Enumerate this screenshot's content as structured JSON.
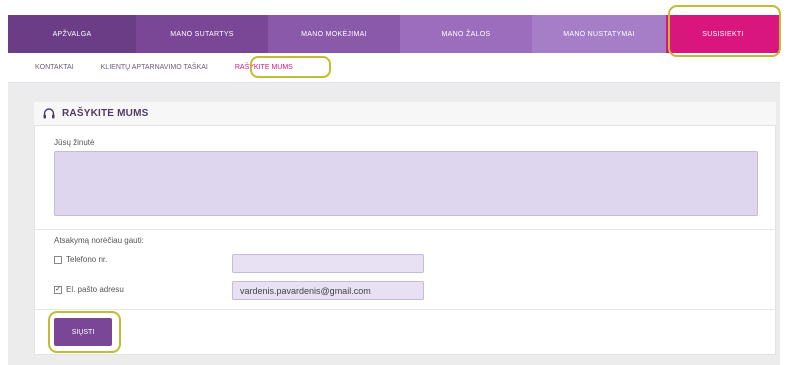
{
  "topnav": {
    "tabs": [
      {
        "label": "APŽVALGA"
      },
      {
        "label": "MANO SUTARTYS"
      },
      {
        "label": "MANO MOKĖJIMAI"
      },
      {
        "label": "MANO ŽALOS"
      },
      {
        "label": "MANO NUSTATYMAI"
      },
      {
        "label": "SUSISIEKTI"
      }
    ],
    "active": "SUSISIEKTI"
  },
  "subnav": {
    "items": [
      {
        "label": "KONTAKTAI"
      },
      {
        "label": "KLIENTŲ APTARNAVIMO TAŠKAI"
      },
      {
        "label": "RAŠYKITE MUMS"
      }
    ],
    "active": "RAŠYKITE MUMS"
  },
  "form": {
    "title": "RAŠYKITE MUMS",
    "message_label": "Jūsų žinutė",
    "message_value": "",
    "reply_label": "Atsakymą norėčiau gauti:",
    "phone": {
      "label": "Telefono nr.",
      "checked": false,
      "value": ""
    },
    "email": {
      "label": "El. pašto adresu",
      "checked": true,
      "value": "vardenis.pavardenis@gmail.com"
    },
    "send_label": "SIŲSTI"
  },
  "colors": {
    "accent": "#d9157e",
    "purple_dark": "#6b3d86",
    "button": "#7a4796",
    "highlight": "#c2bb35",
    "input_bg": "#ddd6ee"
  }
}
